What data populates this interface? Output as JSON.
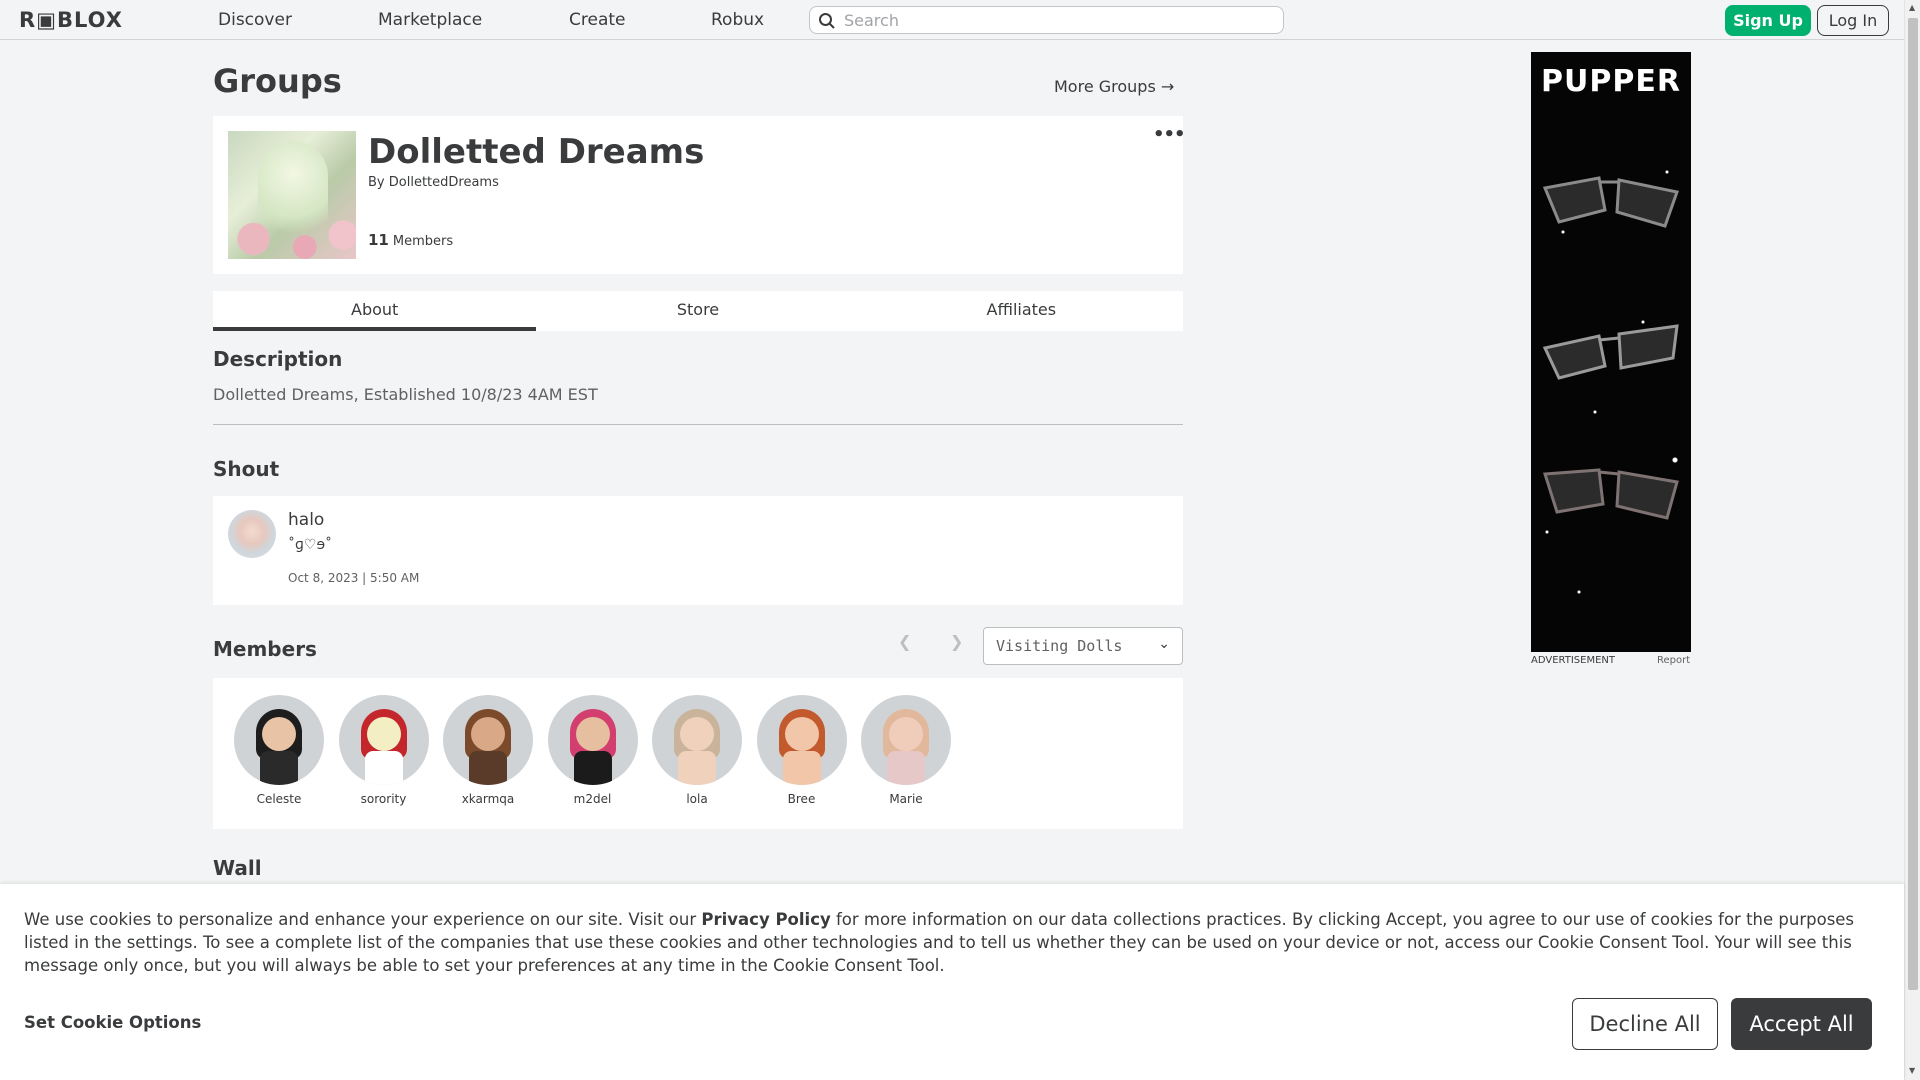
{
  "nav": {
    "logo": "R▣BLOX",
    "links": [
      "Discover",
      "Marketplace",
      "Create",
      "Robux"
    ],
    "search_placeholder": "Search",
    "signup": "Sign Up",
    "login": "Log In"
  },
  "page": {
    "title": "Groups",
    "more_groups": "More Groups →"
  },
  "group": {
    "name": "Dolletted Dreams",
    "by_label": "By",
    "owner": "DollettedDreams",
    "member_count": "11",
    "members_label": "Members",
    "more_icon": "•••"
  },
  "tabs": [
    "About",
    "Store",
    "Affiliates"
  ],
  "description": {
    "title": "Description",
    "text": "Dolletted Dreams, Established 10/8/23 4AM EST"
  },
  "shout": {
    "title": "Shout",
    "user": "halo",
    "body": "˚ɡ♡ɘ˚",
    "date": "Oct 8, 2023 | 5:50 AM"
  },
  "members": {
    "title": "Members",
    "role_selected": "Visiting Dolls",
    "list": [
      {
        "name": "Celeste",
        "skin": "#e9c3a5",
        "hair": "#1d1d1d",
        "body": "#2a2a2a"
      },
      {
        "name": "sorority",
        "skin": "#f4eec4",
        "hair": "#c3272b",
        "body": "#ffffff"
      },
      {
        "name": "xkarmqa",
        "skin": "#d9a886",
        "hair": "#7a4a2a",
        "body": "#5a3a28"
      },
      {
        "name": "m2del",
        "skin": "#e6bfa0",
        "hair": "#d23e6e",
        "body": "#1b1b1b"
      },
      {
        "name": "lola",
        "skin": "#f0d1bc",
        "hair": "#c9b39b",
        "body": "#f0d1bc"
      },
      {
        "name": "Bree",
        "skin": "#f2c6a8",
        "hair": "#c25a2e",
        "body": "#f2c6a8"
      },
      {
        "name": "Marie",
        "skin": "#f0cdbb",
        "hair": "#e2b89c",
        "body": "#e7c8c8"
      }
    ]
  },
  "wall": {
    "title": "Wall"
  },
  "ad": {
    "brand": "PUPPER",
    "label": "ADVERTISEMENT",
    "report": "Report"
  },
  "cookie": {
    "text_before": "We use cookies to personalize and enhance your experience on our site. Visit our ",
    "privacy_link": "Privacy Policy",
    "text_after": " for more information on our data collections practices. By clicking Accept, you agree to our use of cookies for the purposes listed in the settings. To see a complete list of the companies that use these cookies and other technologies and to tell us whether they can be used on your device or not, access our Cookie Consent Tool. Your will see this message only once, but you will always be able to set your preferences at any time in the Cookie Consent Tool.",
    "set_options": "Set Cookie Options",
    "decline": "Decline All",
    "accept": "Accept All"
  },
  "colors": {
    "accent_green": "#00b06f",
    "text_dark": "#393b3d",
    "bg": "#f2f4f5"
  }
}
